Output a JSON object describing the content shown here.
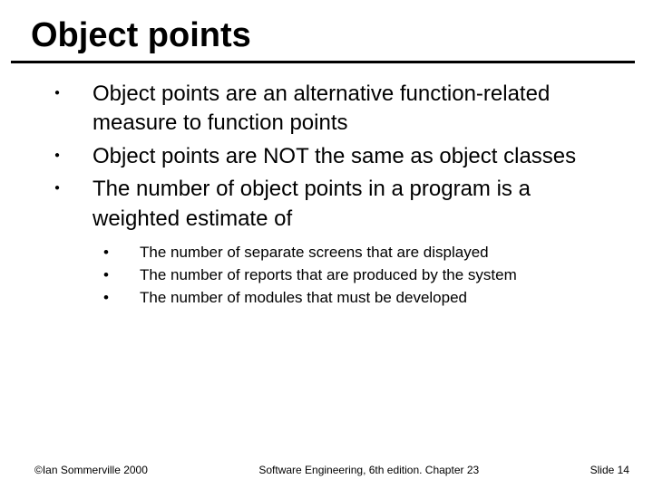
{
  "title": "Object points",
  "bullets": [
    "Object points are an alternative function-related measure to function points",
    "Object points are NOT the same as object classes",
    " The number of object points in a program is a weighted estimate of"
  ],
  "sub_bullets": [
    "The number of separate screens that are displayed",
    "The number of reports that are produced by the system",
    "The number of modules that must be developed"
  ],
  "footer": {
    "left": "©Ian Sommerville 2000",
    "center": "Software Engineering, 6th edition. Chapter 23",
    "right": "Slide 14"
  }
}
